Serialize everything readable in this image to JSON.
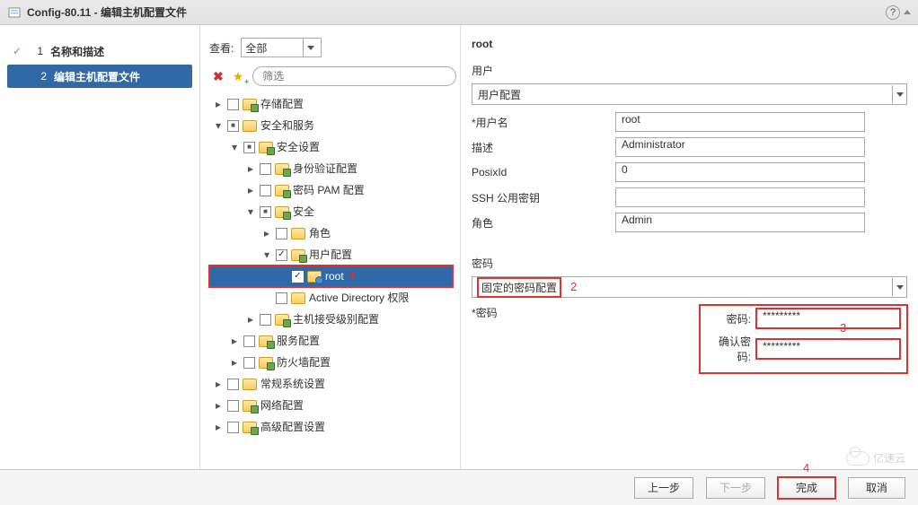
{
  "title": "Config-80.11 - 编辑主机配置文件",
  "steps": [
    {
      "num": "1",
      "label": "名称和描述",
      "state": "done"
    },
    {
      "num": "2",
      "label": "编辑主机配置文件",
      "state": "active"
    }
  ],
  "mid": {
    "view_label": "查看:",
    "view_value": "全部",
    "filter_placeholder": "筛选"
  },
  "tree": [
    {
      "ind": 0,
      "toggle": ">",
      "cb": "",
      "folder": "special",
      "label": "存储配置"
    },
    {
      "ind": 0,
      "toggle": "v",
      "cb": "mixed",
      "folder": "plain",
      "label": "安全和服务"
    },
    {
      "ind": 1,
      "toggle": "v",
      "cb": "mixed",
      "folder": "special",
      "label": "安全设置"
    },
    {
      "ind": 2,
      "toggle": ">",
      "cb": "",
      "folder": "special",
      "label": "身份验证配置"
    },
    {
      "ind": 2,
      "toggle": ">",
      "cb": "",
      "folder": "special",
      "label": "密码 PAM 配置"
    },
    {
      "ind": 2,
      "toggle": "v",
      "cb": "mixed",
      "folder": "special",
      "label": "安全"
    },
    {
      "ind": 3,
      "toggle": ">",
      "cb": "",
      "folder": "plain",
      "label": "角色"
    },
    {
      "ind": 3,
      "toggle": "v",
      "cb": "checked",
      "folder": "special",
      "label": "用户配置"
    },
    {
      "ind": 4,
      "toggle": "none",
      "cb": "checked",
      "folder": "user",
      "label": "root",
      "selected": true,
      "annot": "1"
    },
    {
      "ind": 3,
      "toggle": "none",
      "cb": "",
      "folder": "plain",
      "label": "Active Directory 权限"
    },
    {
      "ind": 2,
      "toggle": ">",
      "cb": "",
      "folder": "special",
      "label": "主机接受级别配置"
    },
    {
      "ind": 1,
      "toggle": ">",
      "cb": "",
      "folder": "special",
      "label": "服务配置"
    },
    {
      "ind": 1,
      "toggle": ">",
      "cb": "",
      "folder": "special",
      "label": "防火墙配置"
    },
    {
      "ind": 0,
      "toggle": ">",
      "cb": "",
      "folder": "plain",
      "label": "常规系统设置"
    },
    {
      "ind": 0,
      "toggle": ">",
      "cb": "",
      "folder": "special",
      "label": "网络配置"
    },
    {
      "ind": 0,
      "toggle": ">",
      "cb": "",
      "folder": "special",
      "label": "高级配置设置"
    }
  ],
  "right": {
    "header": "root",
    "user_section": "用户",
    "user_combo": "用户配置",
    "fields": {
      "username_label": "*用户名",
      "username_value": "root",
      "desc_label": "描述",
      "desc_value": "Administrator",
      "posix_label": "PosixId",
      "posix_value": "0",
      "ssh_label": "SSH 公用密钥",
      "ssh_value": "",
      "role_label": "角色",
      "role_value": "Admin"
    },
    "pw_section": "密码",
    "pw_combo": "固定的密码配置",
    "pw_annot": "2",
    "pw_label": "*密码",
    "pw_field1_label": "密码:",
    "pw_field1_value": "*********",
    "pw_field2_label": "确认密码:",
    "pw_field2_value": "*********",
    "pw_fields_annot": "3"
  },
  "footer": {
    "back": "上一步",
    "next": "下一步",
    "finish": "完成",
    "finish_annot": "4",
    "cancel": "取消"
  },
  "watermark": "亿速云"
}
